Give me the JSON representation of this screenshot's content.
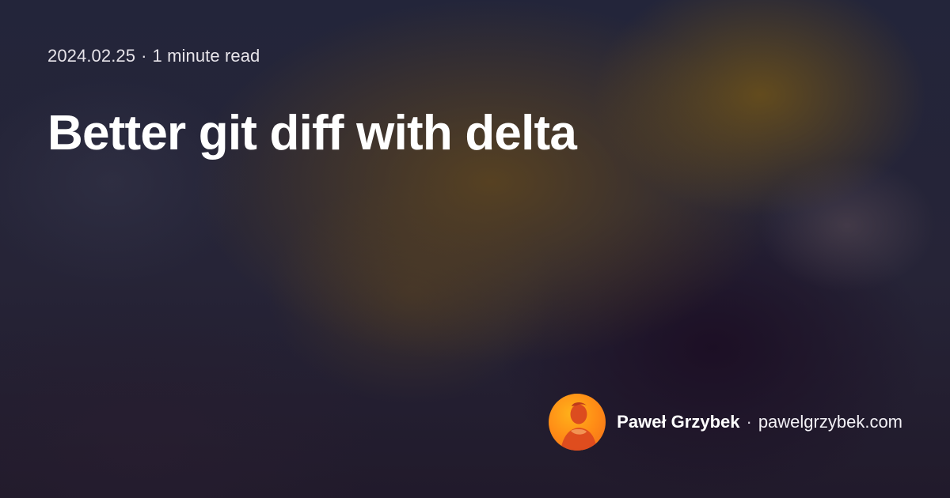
{
  "meta": {
    "date": "2024.02.25",
    "separator": "·",
    "read_time": "1 minute read"
  },
  "title": "Better git diff with delta",
  "footer": {
    "author": "Paweł Grzybek",
    "separator": "·",
    "site": "pawelgrzybek.com",
    "avatar_icon": "profile-photo-avatar"
  }
}
